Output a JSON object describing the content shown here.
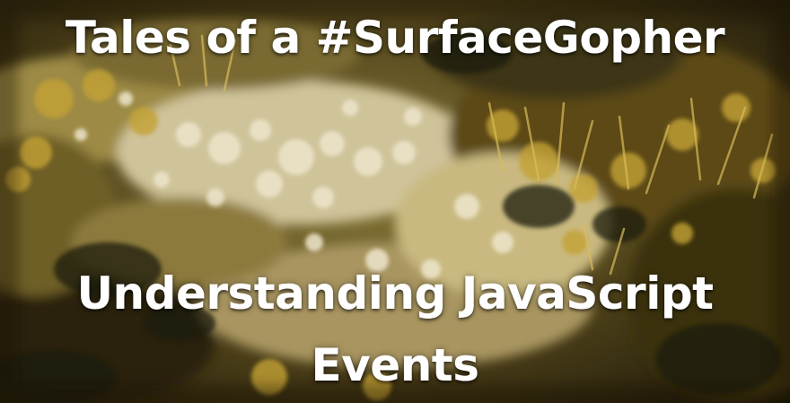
{
  "blog": {
    "title": "Tales of a #SurfaceGopher"
  },
  "post": {
    "title_line_1": "Understanding JavaScript",
    "title_line_2": "Events"
  },
  "palette": {
    "gold": "#b8952a",
    "dark": "#2a2410",
    "cream": "#e8dfc4",
    "text": "#ffffff"
  }
}
